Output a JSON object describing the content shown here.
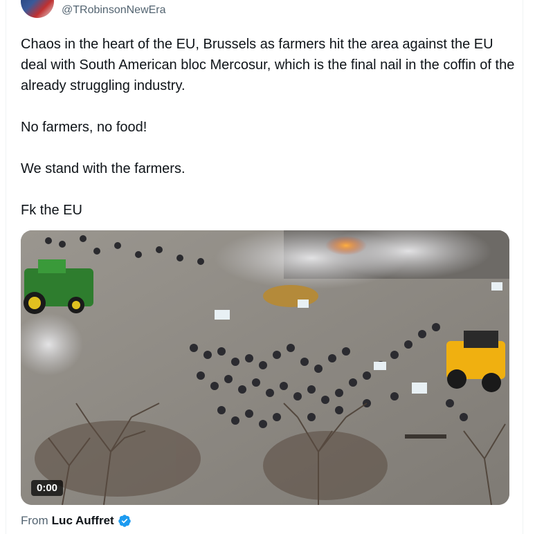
{
  "tweet": {
    "handle": "@TRobinsonNewEra",
    "paragraphs": [
      "Chaos in the heart of the EU, Brussels as farmers hit the area against the EU deal with South American bloc Mercosur, which is the final nail in the coffin of the already struggling industry.",
      "No farmers, no food!",
      "We stand with the farmers.",
      "Fk the EU"
    ]
  },
  "media": {
    "type": "video",
    "timestamp": "0:00"
  },
  "attribution": {
    "prefix": "From",
    "author": "Luc Auffret",
    "verified_color": "#1d9bf0"
  }
}
